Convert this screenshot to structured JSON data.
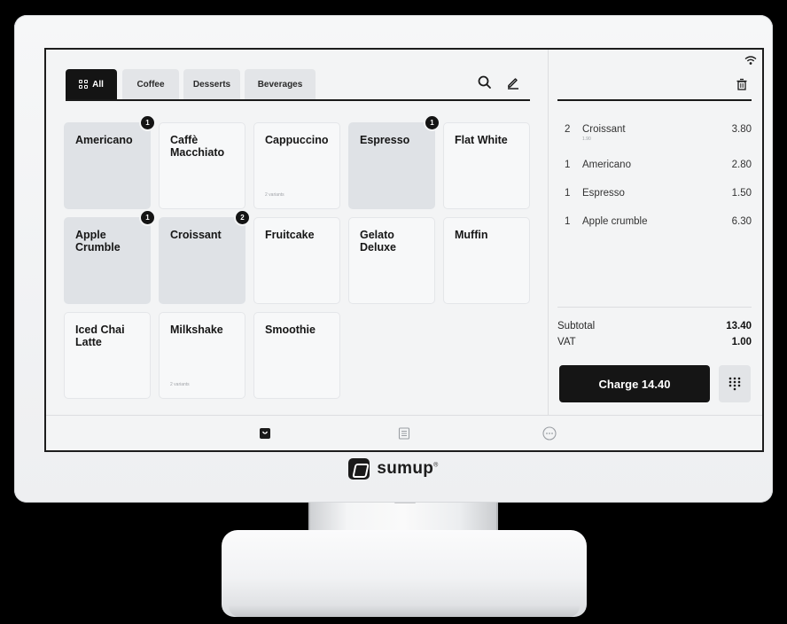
{
  "tabs": [
    {
      "label": "All",
      "icon": "grid-icon",
      "active": true
    },
    {
      "label": "Coffee",
      "active": false
    },
    {
      "label": "Desserts",
      "active": false
    },
    {
      "label": "Beverages",
      "active": false
    }
  ],
  "toolbar": {
    "search_icon": "search-icon",
    "edit_icon": "pencil-icon"
  },
  "products": [
    {
      "name": "Americano",
      "badge": "1",
      "selected": true,
      "sub": ""
    },
    {
      "name": "Caffè Macchiato",
      "badge": "",
      "selected": false,
      "sub": ""
    },
    {
      "name": "Cappuccino",
      "badge": "",
      "selected": false,
      "sub": "2 variants"
    },
    {
      "name": "Espresso",
      "badge": "1",
      "selected": true,
      "sub": ""
    },
    {
      "name": "Flat White",
      "badge": "",
      "selected": false,
      "sub": ""
    },
    {
      "name": "Apple Crumble",
      "badge": "1",
      "selected": true,
      "sub": ""
    },
    {
      "name": "Croissant",
      "badge": "2",
      "selected": true,
      "sub": ""
    },
    {
      "name": "Fruitcake",
      "badge": "",
      "selected": false,
      "sub": ""
    },
    {
      "name": "Gelato Deluxe",
      "badge": "",
      "selected": false,
      "sub": ""
    },
    {
      "name": "Muffin",
      "badge": "",
      "selected": false,
      "sub": ""
    },
    {
      "name": "Iced Chai Latte",
      "badge": "",
      "selected": false,
      "sub": ""
    },
    {
      "name": "Milkshake",
      "badge": "",
      "selected": false,
      "sub": "2 variants"
    },
    {
      "name": "Smoothie",
      "badge": "",
      "selected": false,
      "sub": ""
    }
  ],
  "cart": {
    "items": [
      {
        "qty": "2",
        "name": "Croissant",
        "price": "3.80",
        "note": "1.90"
      },
      {
        "qty": "1",
        "name": "Americano",
        "price": "2.80",
        "note": ""
      },
      {
        "qty": "1",
        "name": "Espresso",
        "price": "1.50",
        "note": ""
      },
      {
        "qty": "1",
        "name": "Apple crumble",
        "price": "6.30",
        "note": ""
      }
    ],
    "subtotal_label": "Subtotal",
    "subtotal_value": "13.40",
    "vat_label": "VAT",
    "vat_value": "1.00",
    "charge_label": "Charge 14.40"
  },
  "nav": [
    "bag-icon",
    "receipt-icon",
    "more-icon"
  ],
  "brand": {
    "name": "sumup",
    "mark": "®"
  },
  "colors": {
    "accent": "#141414",
    "selected_card": "#dfe2e6",
    "screen_bg": "#f3f4f5"
  }
}
